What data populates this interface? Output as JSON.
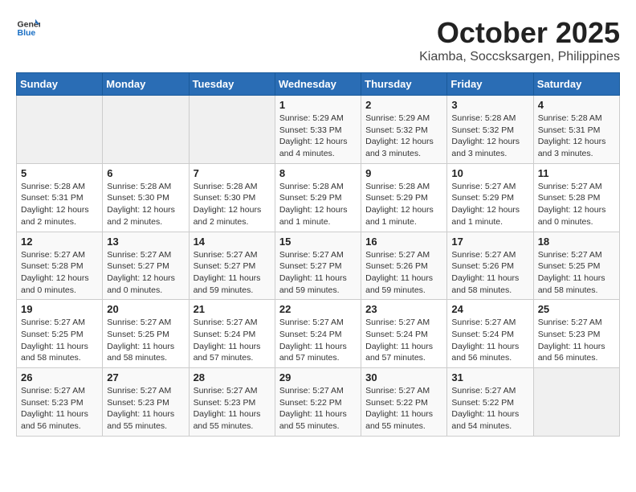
{
  "header": {
    "logo_general": "General",
    "logo_blue": "Blue",
    "month": "October 2025",
    "location": "Kiamba, Soccsksargen, Philippines"
  },
  "days_of_week": [
    "Sunday",
    "Monday",
    "Tuesday",
    "Wednesday",
    "Thursday",
    "Friday",
    "Saturday"
  ],
  "weeks": [
    [
      {
        "day": "",
        "info": ""
      },
      {
        "day": "",
        "info": ""
      },
      {
        "day": "",
        "info": ""
      },
      {
        "day": "1",
        "info": "Sunrise: 5:29 AM\nSunset: 5:33 PM\nDaylight: 12 hours\nand 4 minutes."
      },
      {
        "day": "2",
        "info": "Sunrise: 5:29 AM\nSunset: 5:32 PM\nDaylight: 12 hours\nand 3 minutes."
      },
      {
        "day": "3",
        "info": "Sunrise: 5:28 AM\nSunset: 5:32 PM\nDaylight: 12 hours\nand 3 minutes."
      },
      {
        "day": "4",
        "info": "Sunrise: 5:28 AM\nSunset: 5:31 PM\nDaylight: 12 hours\nand 3 minutes."
      }
    ],
    [
      {
        "day": "5",
        "info": "Sunrise: 5:28 AM\nSunset: 5:31 PM\nDaylight: 12 hours\nand 2 minutes."
      },
      {
        "day": "6",
        "info": "Sunrise: 5:28 AM\nSunset: 5:30 PM\nDaylight: 12 hours\nand 2 minutes."
      },
      {
        "day": "7",
        "info": "Sunrise: 5:28 AM\nSunset: 5:30 PM\nDaylight: 12 hours\nand 2 minutes."
      },
      {
        "day": "8",
        "info": "Sunrise: 5:28 AM\nSunset: 5:29 PM\nDaylight: 12 hours\nand 1 minute."
      },
      {
        "day": "9",
        "info": "Sunrise: 5:28 AM\nSunset: 5:29 PM\nDaylight: 12 hours\nand 1 minute."
      },
      {
        "day": "10",
        "info": "Sunrise: 5:27 AM\nSunset: 5:29 PM\nDaylight: 12 hours\nand 1 minute."
      },
      {
        "day": "11",
        "info": "Sunrise: 5:27 AM\nSunset: 5:28 PM\nDaylight: 12 hours\nand 0 minutes."
      }
    ],
    [
      {
        "day": "12",
        "info": "Sunrise: 5:27 AM\nSunset: 5:28 PM\nDaylight: 12 hours\nand 0 minutes."
      },
      {
        "day": "13",
        "info": "Sunrise: 5:27 AM\nSunset: 5:27 PM\nDaylight: 12 hours\nand 0 minutes."
      },
      {
        "day": "14",
        "info": "Sunrise: 5:27 AM\nSunset: 5:27 PM\nDaylight: 11 hours\nand 59 minutes."
      },
      {
        "day": "15",
        "info": "Sunrise: 5:27 AM\nSunset: 5:27 PM\nDaylight: 11 hours\nand 59 minutes."
      },
      {
        "day": "16",
        "info": "Sunrise: 5:27 AM\nSunset: 5:26 PM\nDaylight: 11 hours\nand 59 minutes."
      },
      {
        "day": "17",
        "info": "Sunrise: 5:27 AM\nSunset: 5:26 PM\nDaylight: 11 hours\nand 58 minutes."
      },
      {
        "day": "18",
        "info": "Sunrise: 5:27 AM\nSunset: 5:25 PM\nDaylight: 11 hours\nand 58 minutes."
      }
    ],
    [
      {
        "day": "19",
        "info": "Sunrise: 5:27 AM\nSunset: 5:25 PM\nDaylight: 11 hours\nand 58 minutes."
      },
      {
        "day": "20",
        "info": "Sunrise: 5:27 AM\nSunset: 5:25 PM\nDaylight: 11 hours\nand 58 minutes."
      },
      {
        "day": "21",
        "info": "Sunrise: 5:27 AM\nSunset: 5:24 PM\nDaylight: 11 hours\nand 57 minutes."
      },
      {
        "day": "22",
        "info": "Sunrise: 5:27 AM\nSunset: 5:24 PM\nDaylight: 11 hours\nand 57 minutes."
      },
      {
        "day": "23",
        "info": "Sunrise: 5:27 AM\nSunset: 5:24 PM\nDaylight: 11 hours\nand 57 minutes."
      },
      {
        "day": "24",
        "info": "Sunrise: 5:27 AM\nSunset: 5:24 PM\nDaylight: 11 hours\nand 56 minutes."
      },
      {
        "day": "25",
        "info": "Sunrise: 5:27 AM\nSunset: 5:23 PM\nDaylight: 11 hours\nand 56 minutes."
      }
    ],
    [
      {
        "day": "26",
        "info": "Sunrise: 5:27 AM\nSunset: 5:23 PM\nDaylight: 11 hours\nand 56 minutes."
      },
      {
        "day": "27",
        "info": "Sunrise: 5:27 AM\nSunset: 5:23 PM\nDaylight: 11 hours\nand 55 minutes."
      },
      {
        "day": "28",
        "info": "Sunrise: 5:27 AM\nSunset: 5:23 PM\nDaylight: 11 hours\nand 55 minutes."
      },
      {
        "day": "29",
        "info": "Sunrise: 5:27 AM\nSunset: 5:22 PM\nDaylight: 11 hours\nand 55 minutes."
      },
      {
        "day": "30",
        "info": "Sunrise: 5:27 AM\nSunset: 5:22 PM\nDaylight: 11 hours\nand 55 minutes."
      },
      {
        "day": "31",
        "info": "Sunrise: 5:27 AM\nSunset: 5:22 PM\nDaylight: 11 hours\nand 54 minutes."
      },
      {
        "day": "",
        "info": ""
      }
    ]
  ]
}
